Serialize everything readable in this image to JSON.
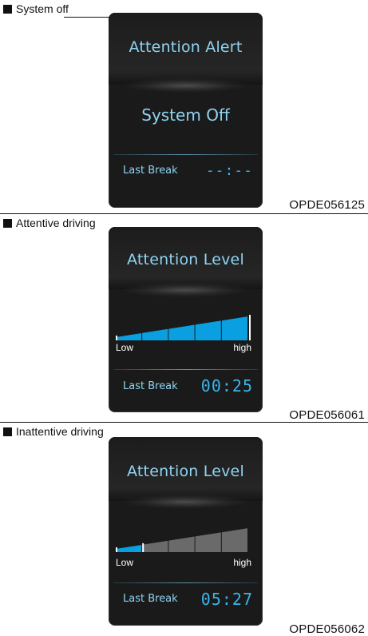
{
  "panels": [
    {
      "caption": "System off",
      "code": "OPDE056125",
      "screen": {
        "title": "Attention Alert",
        "center_text": "System Off",
        "last_break_label": "Last Break",
        "last_break_value": "--:--"
      }
    },
    {
      "caption": "Attentive driving",
      "code": "OPDE056061",
      "screen": {
        "title": "Attention Level",
        "low_label": "Low",
        "high_label": "high",
        "level_segments_filled": 5,
        "level_segments_total": 5,
        "last_break_label": "Last Break",
        "last_break_value": "00:25"
      }
    },
    {
      "caption": "Inattentive driving",
      "code": "OPDE056062",
      "screen": {
        "title": "Attention Level",
        "low_label": "Low",
        "high_label": "high",
        "level_segments_filled": 1,
        "level_segments_total": 5,
        "last_break_label": "Last Break",
        "last_break_value": "05:27"
      }
    }
  ],
  "colors": {
    "text_cyan": "#8fd4f2",
    "value_blue": "#39b6ea",
    "gauge_blue": "#0a9fe0",
    "gauge_gray": "#6a6a6a",
    "screen_bg": "#1a1a1a"
  }
}
